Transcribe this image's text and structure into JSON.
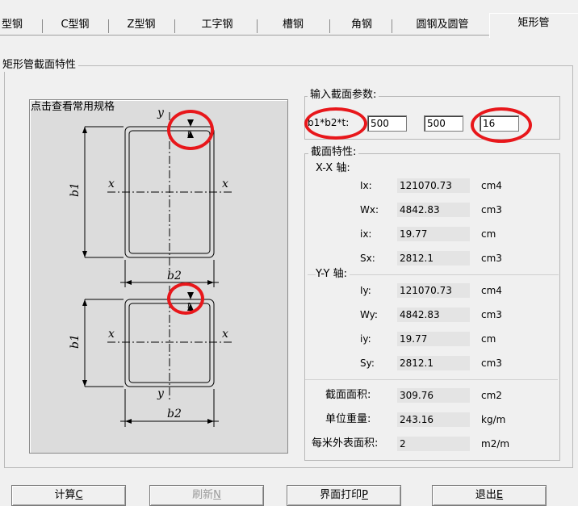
{
  "tabs": [
    {
      "label": "型钢"
    },
    {
      "label": "C型钢"
    },
    {
      "label": "Z型钢"
    },
    {
      "label": "工字钢"
    },
    {
      "label": "槽钢"
    },
    {
      "label": "角钢"
    },
    {
      "label": "圆钢及圆管"
    },
    {
      "label": "矩形管"
    }
  ],
  "section_group": {
    "label": "矩形管截面特性"
  },
  "diagram": {
    "caption": "点击查看常用规格"
  },
  "input_group": {
    "label": "输入截面参数:",
    "param_label": "b1*b2*t:",
    "b1": "500",
    "b2": "500",
    "t": "16"
  },
  "props": {
    "label": "截面特性:",
    "xx": {
      "title": "X-X 轴:",
      "rows": [
        {
          "name": "Ix:",
          "value": "121070.73",
          "unit": "cm4"
        },
        {
          "name": "Wx:",
          "value": "4842.83",
          "unit": "cm3"
        },
        {
          "name": "ix:",
          "value": "19.77",
          "unit": "cm"
        },
        {
          "name": "Sx:",
          "value": "2812.1",
          "unit": "cm3"
        }
      ]
    },
    "yy": {
      "title": "Y-Y 轴:",
      "rows": [
        {
          "name": "Iy:",
          "value": "121070.73",
          "unit": "cm4"
        },
        {
          "name": "Wy:",
          "value": "4842.83",
          "unit": "cm3"
        },
        {
          "name": "iy:",
          "value": "19.77",
          "unit": "cm"
        },
        {
          "name": "Sy:",
          "value": "2812.1",
          "unit": "cm3"
        }
      ]
    },
    "area": {
      "name": "截面面积:",
      "value": "309.76",
      "unit": "cm2"
    },
    "weight": {
      "name": "单位重量:",
      "value": "243.16",
      "unit": "kg/m"
    },
    "surface": {
      "name": "每米外表面积:",
      "value": "2",
      "unit": "m2/m"
    }
  },
  "buttons": {
    "calc": {
      "text": "计算",
      "key": "C"
    },
    "refresh": {
      "text": "刷新",
      "key": "N"
    },
    "print": {
      "text": "界面打印",
      "key": "P"
    },
    "exit": {
      "text": "退出",
      "key": "E"
    }
  },
  "colors": {
    "highlight": "#e8171b",
    "panel": "#dcdcdc",
    "field": "#e4e4e4"
  }
}
